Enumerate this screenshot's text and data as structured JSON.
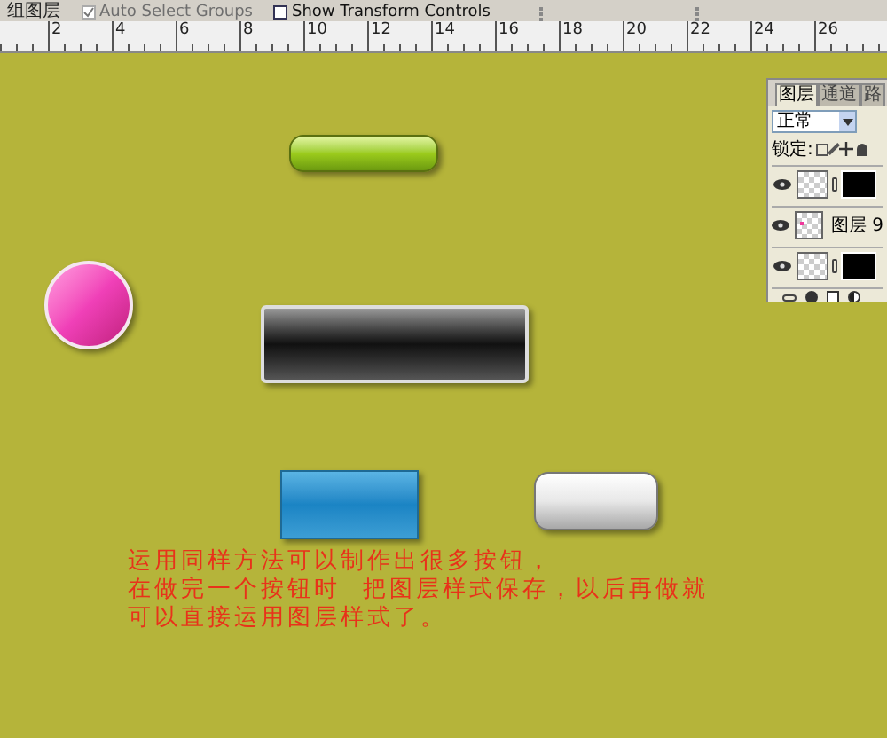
{
  "options_bar": {
    "left_label": "组图层",
    "checks": [
      {
        "label": "Auto Select Groups",
        "checked": true,
        "disabled": true
      },
      {
        "label": "Show Transform Controls",
        "checked": false,
        "disabled": false
      }
    ]
  },
  "ruler": {
    "ticks": [
      "2",
      "4",
      "6",
      "8",
      "10",
      "12",
      "14",
      "16",
      "18",
      "20",
      "22",
      "24",
      "26"
    ]
  },
  "canvas": {
    "shapes": [
      {
        "kind": "pill"
      },
      {
        "kind": "circle"
      },
      {
        "kind": "bar"
      },
      {
        "kind": "rect"
      },
      {
        "kind": "rounded"
      }
    ],
    "caption_lines": [
      "运用同样方法可以制作出很多按钮，",
      "在做完一个按钮时  把图层样式保存，以后再做就",
      "可以直接运用图层样式了。"
    ]
  },
  "layers_panel": {
    "tabs": [
      {
        "label": "图层",
        "selected": true
      },
      {
        "label": "通道",
        "selected": false
      },
      {
        "label": "路",
        "selected": false
      }
    ],
    "blend_mode": "正常",
    "lock_label": "锁定:",
    "layers": [
      {
        "kind": "masked",
        "visible": true
      },
      {
        "kind": "named",
        "name": "图层 9",
        "visible": true
      },
      {
        "kind": "masked",
        "visible": true
      }
    ]
  }
}
